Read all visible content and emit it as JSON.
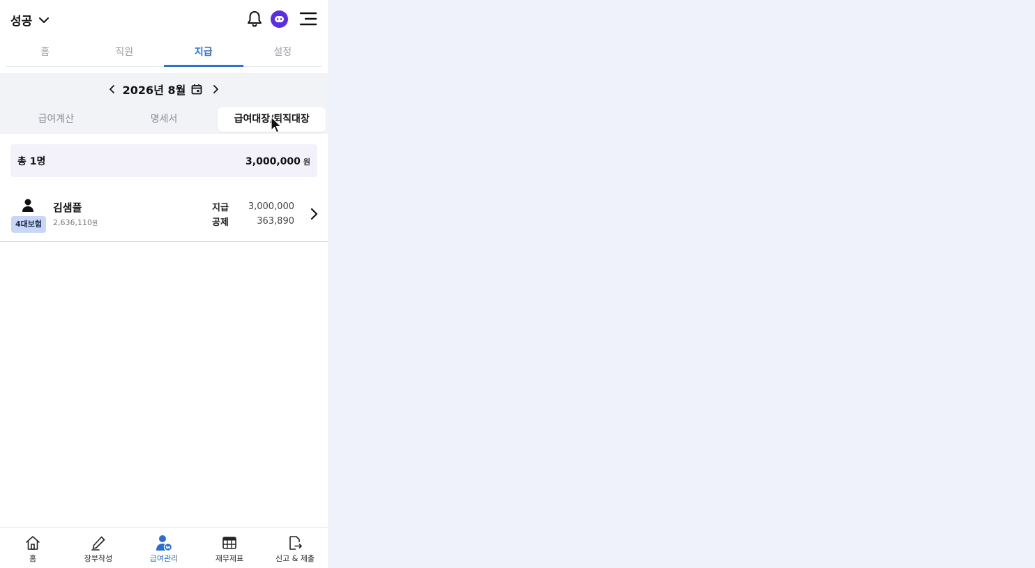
{
  "header": {
    "company": "성공"
  },
  "top_tabs": [
    {
      "label": "홈",
      "active": false
    },
    {
      "label": "직원",
      "active": false
    },
    {
      "label": "지급",
      "active": true
    },
    {
      "label": "설정",
      "active": false
    }
  ],
  "month": {
    "label": "2026년 8월"
  },
  "segment_tabs": [
    {
      "label": "급여계산",
      "active": false
    },
    {
      "label": "명세서",
      "active": false
    },
    {
      "label": "급여대장/퇴직대장",
      "active": true
    }
  ],
  "summary": {
    "count": "총 1명",
    "total": "3,000,000",
    "unit": "원"
  },
  "employees": [
    {
      "name": "김샘플",
      "badge": "4대보험",
      "net": "2,636,110",
      "net_unit": "원",
      "pay_label": "지급",
      "pay_value": "3,000,000",
      "deduct_label": "공제",
      "deduct_value": "363,890"
    }
  ],
  "bottom_nav": [
    {
      "label": "홈",
      "icon": "home-icon",
      "active": false
    },
    {
      "label": "장부작성",
      "icon": "pencil-icon",
      "active": false
    },
    {
      "label": "급여관리",
      "icon": "payroll-user-icon",
      "active": true
    },
    {
      "label": "재무제표",
      "icon": "table-icon",
      "active": false
    },
    {
      "label": "신고 & 제출",
      "icon": "file-export-icon",
      "active": false
    }
  ],
  "colors": {
    "accent": "#2f6fd6",
    "chatbot": "#5b2ee6",
    "badge_bg": "#c9d6f7",
    "summary_bg": "#f3f2fb",
    "page_bg": "#eff2fa"
  }
}
